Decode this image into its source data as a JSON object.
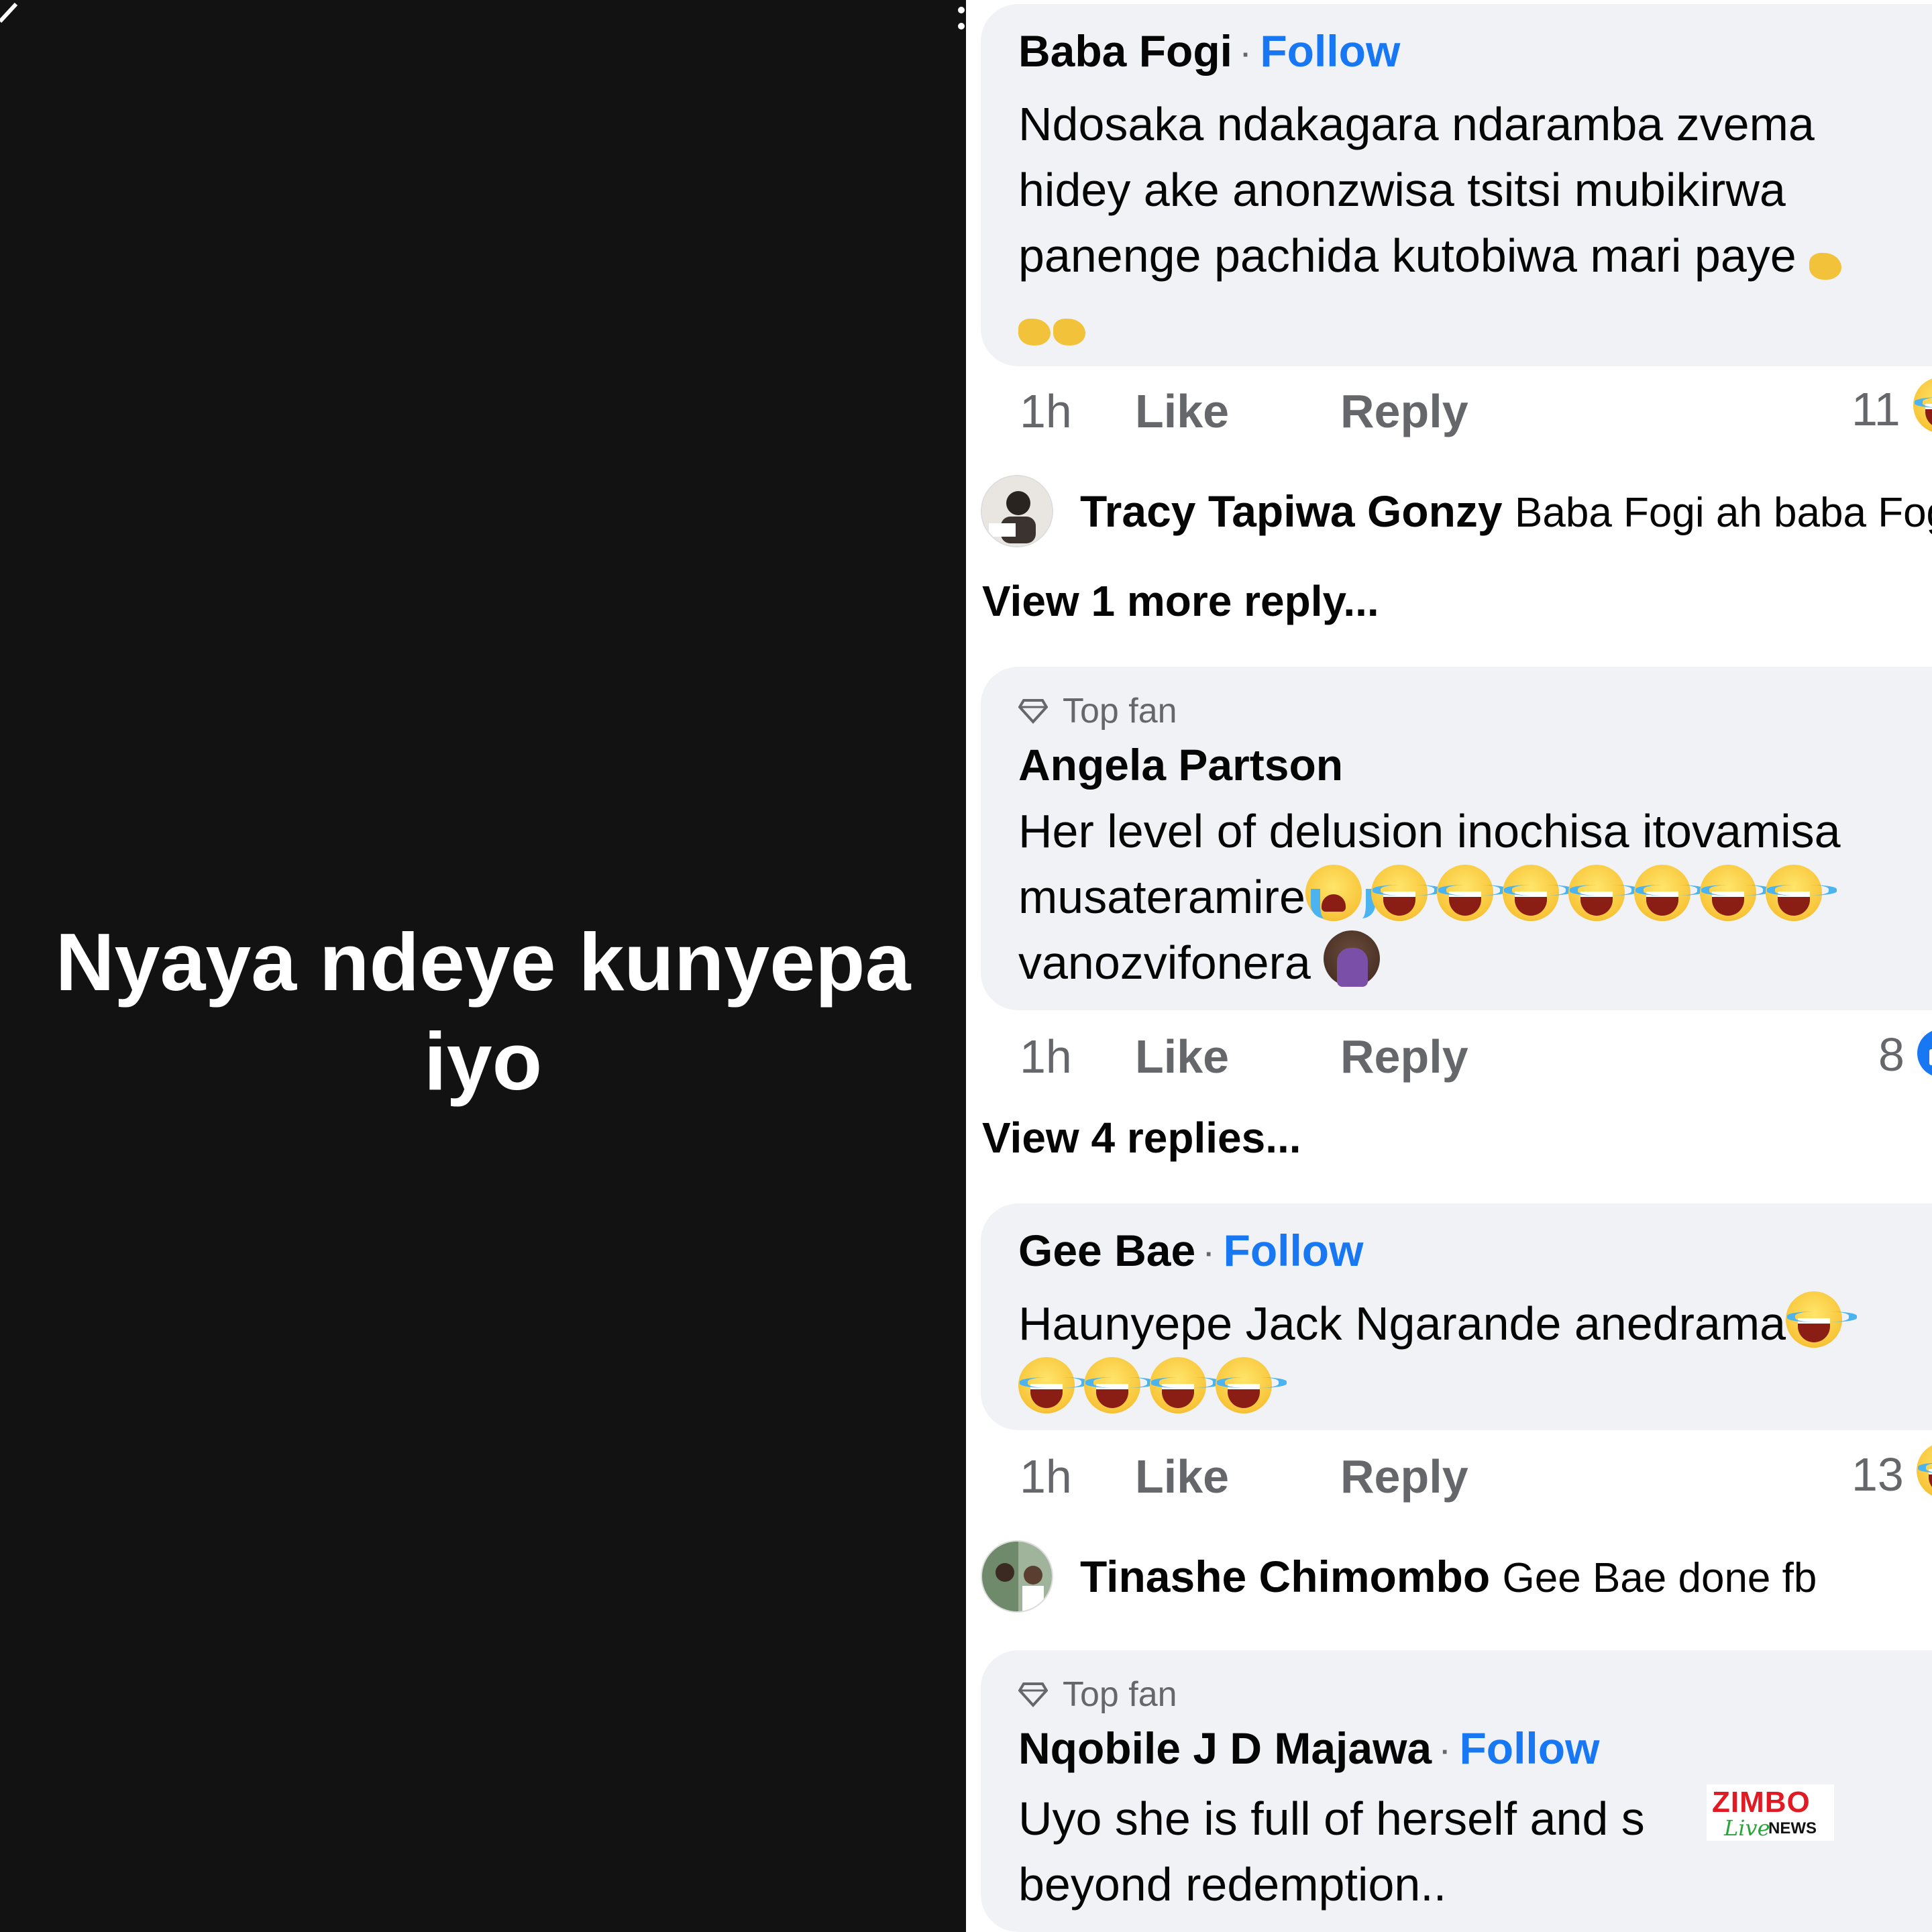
{
  "story": {
    "text_line1": "Nyaya ndeye kunyepa",
    "text_line2": "iyo"
  },
  "comments": [
    {
      "name": "Baba Fogi",
      "follow": "Follow",
      "lines": [
        "Ndosaka ndakagara ndaramba zvema",
        "hidey ake anonzwisa tsitsi mubikirwa",
        "panenge pachida kutobiwa mari paye"
      ],
      "time": "1h",
      "like": "Like",
      "reply": "Reply",
      "count": "11"
    },
    {
      "badge": "Top fan",
      "name": "Angela Partson",
      "lines": [
        "Her level of delusion inochisa itovamisa",
        "musateramire",
        "vanozvifonera"
      ],
      "time": "1h",
      "like": "Like",
      "reply": "Reply",
      "count": "8"
    },
    {
      "name": "Gee Bae",
      "follow": "Follow",
      "lines": [
        "Haunyepe Jack Ngarande anedrama"
      ],
      "time": "1h",
      "like": "Like",
      "reply": "Reply",
      "count": "13"
    },
    {
      "badge": "Top fan",
      "name": "Nqobile J D Majawa",
      "follow": "Follow",
      "lines": [
        "Uyo she is full of herself and s",
        "beyond redemption.."
      ]
    }
  ],
  "replies": [
    {
      "name": "Tracy Tapiwa Gonzy",
      "text": "Baba Fogi ah baba Fog"
    },
    {
      "name": "Tinashe Chimombo",
      "text": "Gee Bae done fb"
    }
  ],
  "view_more": [
    "View 1 more reply...",
    "View 4 replies..."
  ],
  "watermark": {
    "line1": "ZIMBO",
    "line2": "Live",
    "line3": "NEWS"
  },
  "icons": [
    "back-arrow-icon",
    "more-options-icon",
    "diamond-icon",
    "like-reaction-icon",
    "haha-reaction-icon",
    "crying-emoji-icon",
    "facepalm-emoji-icon",
    "clapping-emoji-icon"
  ],
  "colors": {
    "story_bg": "#121212",
    "bubble_bg": "#f0f2f5",
    "follow": "#1877f2",
    "muted": "#65676b",
    "watermark_red": "#e01b24",
    "watermark_green": "#2aa43a"
  }
}
